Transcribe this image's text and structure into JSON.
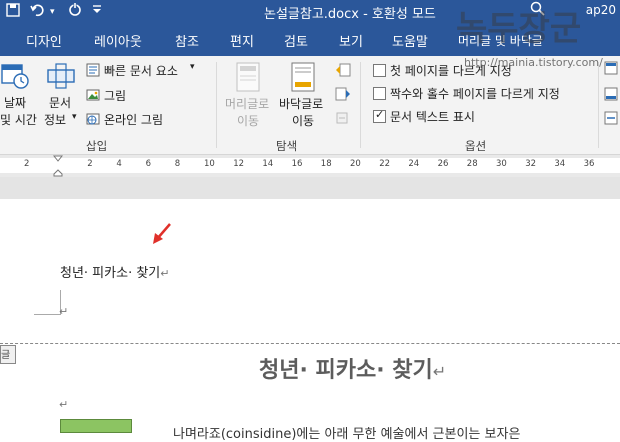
{
  "titlebar": {
    "doc_title": "논설글참고.docx - 호환성 모드",
    "user": "ap20"
  },
  "tabs": [
    "디자인",
    "레이아웃",
    "참조",
    "편지",
    "검토",
    "보기",
    "도움말",
    "머리글 및 바닥글"
  ],
  "ribbon": {
    "insert": {
      "date_time": [
        "날짜",
        "및 시간"
      ],
      "doc_info": [
        "문서",
        "정보"
      ],
      "quick_parts": "빠른 문서 요소",
      "picture": "그림",
      "online_picture": "온라인 그림",
      "group_label": "삽입"
    },
    "nav": {
      "header_btn": [
        "머리글로",
        "이동"
      ],
      "footer_btn": [
        "바닥글로",
        "이동"
      ],
      "group_label": "탐색"
    },
    "options": {
      "first_page": "첫 페이지를 다르게 지정",
      "odd_even": "짝수와 홀수 페이지를 다르게 지정",
      "show_doc_text": "문서 텍스트 표시",
      "checked": [
        false,
        false,
        true
      ],
      "group_label": "옵션"
    }
  },
  "ruler": {
    "ticks": [
      "2",
      "2",
      "4",
      "6",
      "8",
      "10",
      "12",
      "14",
      "16",
      "18",
      "20",
      "22",
      "24",
      "26",
      "28",
      "30",
      "32",
      "34",
      "36"
    ]
  },
  "document": {
    "header_line": "청년· 피카소· 찾기",
    "return_mark": "↵",
    "side_label": "글",
    "heading": "청년· 피카소· 찾기",
    "body_partial": "나며라죠(coinsidine)에는 아래 무한 예술에서 근본이는 보자은"
  },
  "watermark": {
    "text_big": "녹두장군",
    "url": "http://mainia.tistory.com/"
  },
  "colors": {
    "word_blue": "#2b579a",
    "ribbon_bg": "#f3f3f3",
    "arrow_red": "#e0302a",
    "green_shape": "#8cc462"
  }
}
